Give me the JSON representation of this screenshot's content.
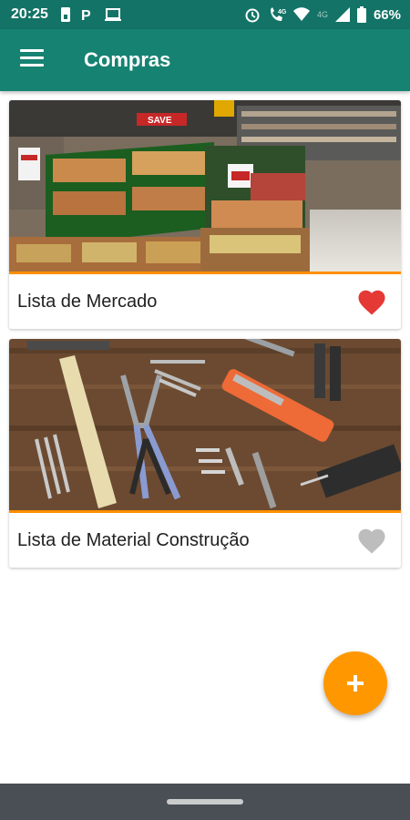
{
  "status_bar": {
    "time": "20:25",
    "battery": "66%",
    "network": "4G",
    "left_icons": [
      "sim-icon",
      "parking-icon",
      "laptop-icon"
    ],
    "right_icons": [
      "alarm-icon",
      "wifi-call-icon",
      "wifi-icon",
      "signal-icon",
      "battery-icon"
    ]
  },
  "app_bar": {
    "title": "Compras"
  },
  "lists": [
    {
      "title": "Lista de Mercado",
      "favorite": true,
      "image": "supermarket-produce"
    },
    {
      "title": "Lista de Material Construção",
      "favorite": false,
      "image": "tools-on-wood"
    }
  ],
  "colors": {
    "primary": "#168272",
    "status_bar": "#137366",
    "accent": "#ff9800",
    "favorite_on": "#e53935",
    "favorite_off": "#bdbdbd"
  }
}
